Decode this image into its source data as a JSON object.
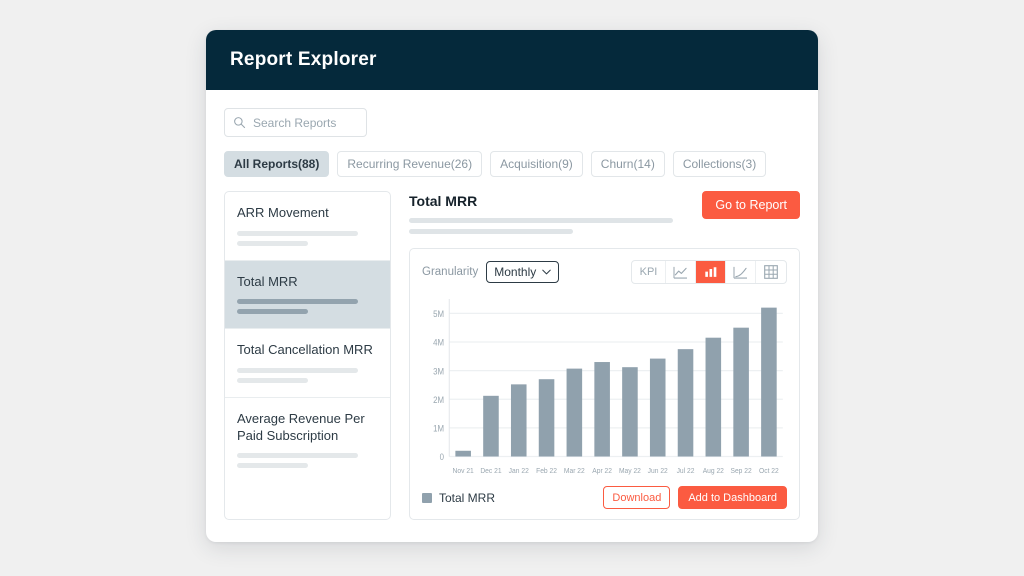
{
  "app": {
    "title": "Report Explorer",
    "accent_color": "#fb5b41",
    "header_color": "#05293b",
    "bar_color": "#90a1ad",
    "page_background": "#f0f0f0"
  },
  "search": {
    "placeholder": "Search Reports",
    "value": "",
    "icon": "search-icon"
  },
  "tabs": [
    {
      "label": "All Reports(88)",
      "active": true
    },
    {
      "label": "Recurring Revenue(26)",
      "active": false
    },
    {
      "label": "Acquisition(9)",
      "active": false
    },
    {
      "label": "Churn(14)",
      "active": false
    },
    {
      "label": "Collections(3)",
      "active": false
    }
  ],
  "report_list": [
    {
      "title": "ARR Movement",
      "selected": false
    },
    {
      "title": "Total MRR",
      "selected": true
    },
    {
      "title": "Total Cancellation MRR",
      "selected": false
    },
    {
      "title": "Average Revenue Per Paid Subscription",
      "selected": false
    }
  ],
  "report": {
    "title": "Total MRR",
    "go_to_report_label": "Go to Report"
  },
  "controls": {
    "granularity_label": "Granularity",
    "granularity_value": "Monthly",
    "granularity_options": [
      "Monthly"
    ],
    "view_types": [
      {
        "name": "kpi",
        "label": "KPI",
        "active": false
      },
      {
        "name": "line-chart-icon",
        "label": "",
        "active": false
      },
      {
        "name": "bar-chart-icon",
        "label": "",
        "active": true
      },
      {
        "name": "area-chart-icon",
        "label": "",
        "active": false
      },
      {
        "name": "table-icon",
        "label": "",
        "active": false
      }
    ]
  },
  "legend": {
    "label": "Total MRR"
  },
  "footer": {
    "download_label": "Download",
    "add_to_dashboard_label": "Add to Dashboard"
  },
  "chart_data": {
    "type": "bar",
    "title": "Total MRR",
    "xlabel": "",
    "ylabel": "",
    "ylim": [
      0,
      5500000
    ],
    "grid": true,
    "legend_position": "bottom-left",
    "y_ticks": [
      0,
      1000000,
      2000000,
      3000000,
      4000000,
      5000000
    ],
    "y_tick_labels": [
      "0",
      "1M",
      "2M",
      "3M",
      "4M",
      "5M"
    ],
    "categories": [
      "Nov 21",
      "Dec 21",
      "Jan 22",
      "Feb 22",
      "Mar 22",
      "Apr 22",
      "May 22",
      "Jun 22",
      "Jul 22",
      "Aug 22",
      "Sep 22",
      "Oct 22"
    ],
    "series": [
      {
        "name": "Total MRR",
        "color": "#90a1ad",
        "values": [
          200000,
          2120000,
          2520000,
          2700000,
          3070000,
          3300000,
          3120000,
          3420000,
          3750000,
          4150000,
          4500000,
          5200000
        ]
      }
    ]
  }
}
